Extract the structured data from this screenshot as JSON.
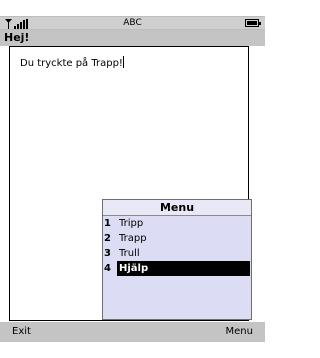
{
  "status": {
    "carrier": "ABC"
  },
  "title": "Hej!",
  "content": {
    "text": "Du tryckte på Trapp!"
  },
  "menu": {
    "title": "Menu",
    "items": [
      {
        "number": "1",
        "label": "Tripp"
      },
      {
        "number": "2",
        "label": "Trapp"
      },
      {
        "number": "3",
        "label": "Trull"
      },
      {
        "number": "4",
        "label": "Hjälp",
        "selected": true
      }
    ]
  },
  "softkeys": {
    "left": "Exit",
    "right": "Menu"
  },
  "colors": {
    "menu_background": "#dcdcf4",
    "bar_gray": "#c4c4c4",
    "selection": "#000000"
  }
}
